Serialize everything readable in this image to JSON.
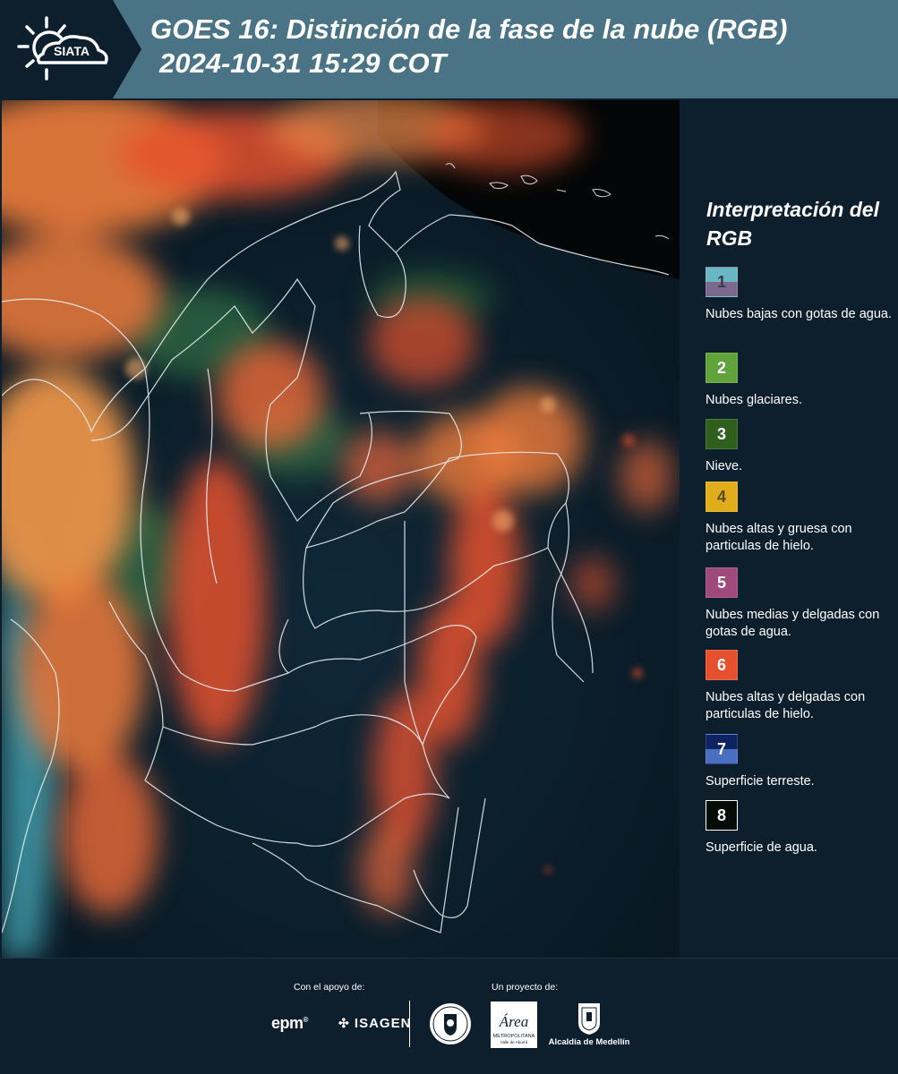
{
  "header": {
    "logo_text": "SIATA",
    "title_line1": "GOES 16: Distinción de la fase de la nube (RGB)",
    "title_line2": "2024-10-31 15:29 COT",
    "band_color": "#4a7485",
    "bg_color": "#0d1e2c"
  },
  "legend": {
    "title": "Interpretación del RGB",
    "items": [
      {
        "number": "1",
        "label": "Nubes bajas con gotas de agua.",
        "color_top": "#6ab7c4",
        "color_bottom": "#7c6a8c"
      },
      {
        "number": "2",
        "label": "Nubes glaciares.",
        "color_top": "#5fa33a",
        "color_bottom": "#5fa33a"
      },
      {
        "number": "3",
        "label": "Nieve.",
        "color_top": "#2f5f1d",
        "color_bottom": "#2f5f1d"
      },
      {
        "number": "4",
        "label": "Nubes altas y gruesa con particulas de hielo.",
        "color_top": "#e0ae1c",
        "color_bottom": "#e0ae1c"
      },
      {
        "number": "5",
        "label": "Nubes medias y delgadas con gotas de agua.",
        "color_top": "#9e4a7c",
        "color_bottom": "#9e4a7c"
      },
      {
        "number": "6",
        "label": "Nubes altas y delgadas con particulas de hielo.",
        "color_top": "#e5512e",
        "color_bottom": "#e5512e"
      },
      {
        "number": "7",
        "label": "Superficie terreste.",
        "color_top": "#0e2462",
        "color_bottom": "#4a6fc2"
      },
      {
        "number": "8",
        "label": "Superficie de agua.",
        "color_top": "#050b07",
        "color_bottom": "#050b07"
      }
    ]
  },
  "footer": {
    "support_label": "Con el apoyo de:",
    "project_label": "Un proyecto de:",
    "sponsor1": "epm",
    "sponsor2": "ISAGEN",
    "area_logo_text": "Área",
    "area_caption": "METROPOLITANA",
    "area_caption2": "Valle de Aburrá",
    "alcaldia": "Alcaldía de Medellín"
  },
  "map": {
    "cloud_colors": {
      "orange": "#f07d3c",
      "red": "#e5512e",
      "cyan": "#4fa6b0",
      "green": "#3d8a4e",
      "land": "#0c1e2e"
    }
  }
}
